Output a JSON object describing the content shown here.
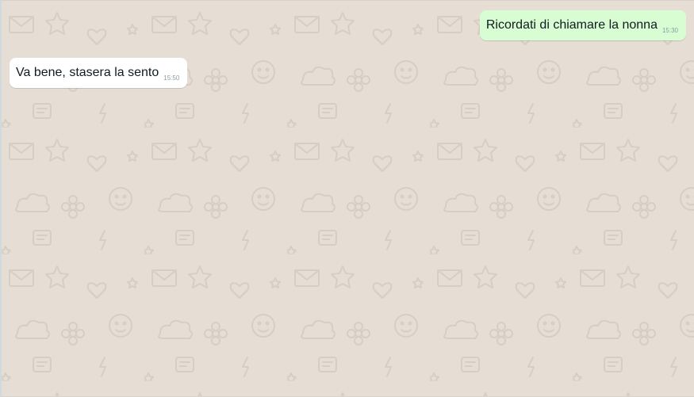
{
  "chat": {
    "wallpaper_color": "#e6ded5",
    "wallpaper_doodle_color": "#d4cbc1",
    "messages": [
      {
        "direction": "outgoing",
        "text": "Ricordati di chiamare la nonna",
        "time": "15:30",
        "bubble_color": "#d9fdd3"
      },
      {
        "direction": "incoming",
        "text": "Va bene, stasera la sento",
        "time": "15:50",
        "bubble_color": "#ffffff"
      }
    ]
  }
}
